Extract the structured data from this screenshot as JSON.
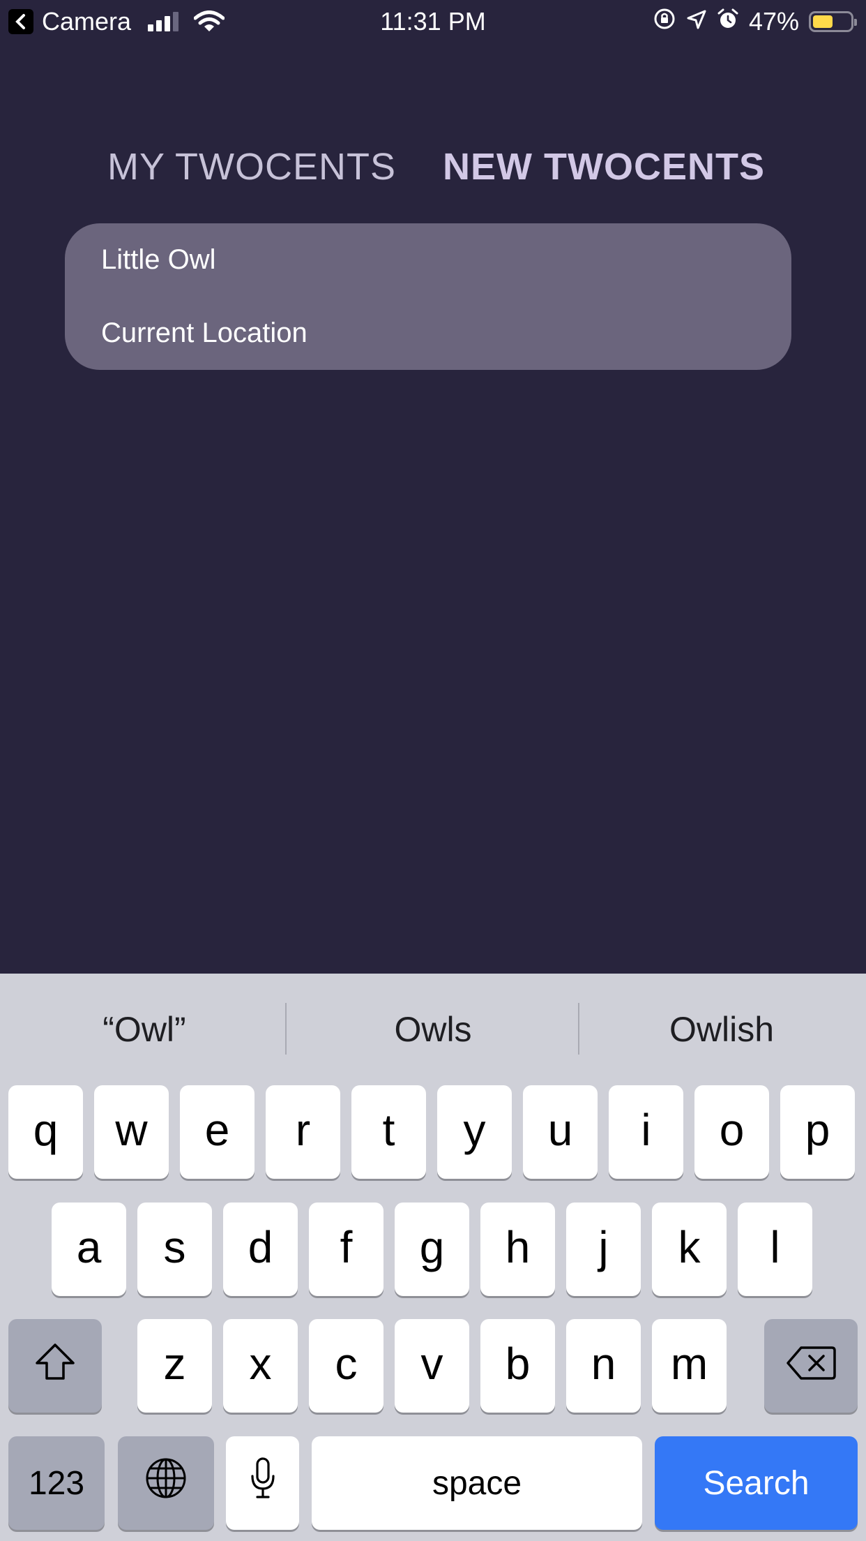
{
  "status_bar": {
    "back_app": "Camera",
    "time": "11:31 PM",
    "battery": "47%",
    "battery_level": 0.47,
    "battery_color": "#ffd94a"
  },
  "tabs": [
    {
      "label": "MY TWOCENTS",
      "active": false
    },
    {
      "label": "NEW TWOCENTS",
      "active": true
    }
  ],
  "dropdown": {
    "options": [
      "Little Owl",
      "Current Location"
    ]
  },
  "keyboard": {
    "suggestions": [
      "“Owl”",
      "Owls",
      "Owlish"
    ],
    "row1": [
      "q",
      "w",
      "e",
      "r",
      "t",
      "y",
      "u",
      "i",
      "o",
      "p"
    ],
    "row2": [
      "a",
      "s",
      "d",
      "f",
      "g",
      "h",
      "j",
      "k",
      "l"
    ],
    "row3": [
      "z",
      "x",
      "c",
      "v",
      "b",
      "n",
      "m"
    ],
    "numbers_key": "123",
    "space_key": "space",
    "search_key": "Search",
    "accent_color": "#3478f6"
  }
}
